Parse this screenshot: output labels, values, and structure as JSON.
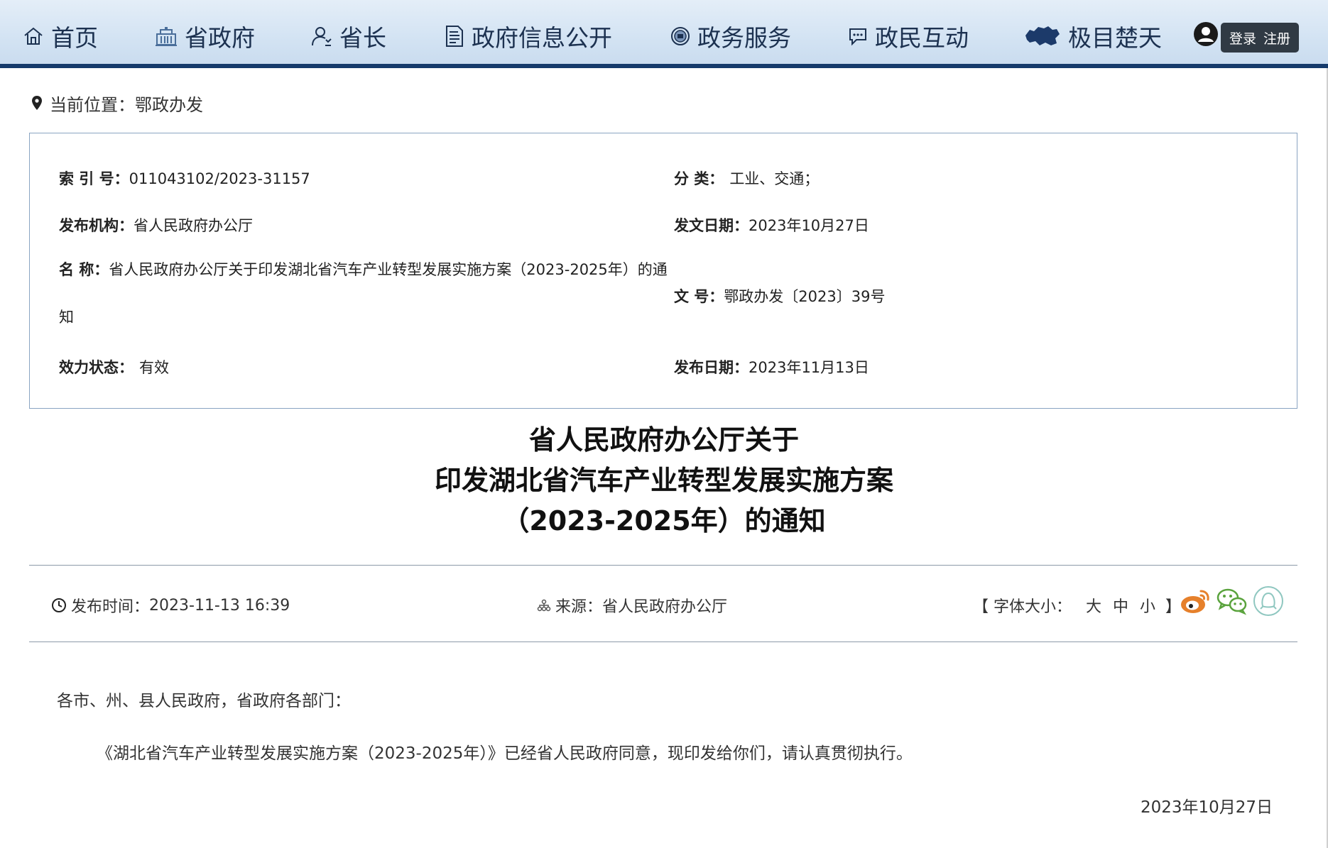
{
  "nav": {
    "items": [
      {
        "label": "首页",
        "icon": "home-icon"
      },
      {
        "label": "省政府",
        "icon": "government-building-icon"
      },
      {
        "label": "省长",
        "icon": "governor-icon"
      },
      {
        "label": "政府信息公开",
        "icon": "document-icon"
      },
      {
        "label": "政务服务",
        "icon": "emblem-icon"
      },
      {
        "label": "政民互动",
        "icon": "chat-icon"
      },
      {
        "label": "极目楚天",
        "icon": "hubei-map-icon"
      }
    ],
    "login": "登录",
    "register": "注册"
  },
  "breadcrumb": {
    "label": "当前位置：",
    "value": "鄂政办发"
  },
  "meta": {
    "index_label": "索 引 号：",
    "index_value": "011043102/2023-31157",
    "category_label": "分 类：",
    "category_value": "工业、交通；",
    "publisher_label": "发布机构：",
    "publisher_value": "省人民政府办公厅",
    "issue_date_label": "发文日期：",
    "issue_date_value": "2023年10月27日",
    "name_label": "名 称：",
    "name_value": "省人民政府办公厅关于印发湖北省汽车产业转型发展实施方案（2023-2025年）的通知",
    "doc_no_label": "文 号：",
    "doc_no_value": "鄂政办发〔2023〕39号",
    "status_label": "效力状态：",
    "status_value": "有效",
    "publish_date_label": "发布日期：",
    "publish_date_value": "2023年11月13日"
  },
  "title": {
    "line1": "省人民政府办公厅关于",
    "line2": "印发湖北省汽车产业转型发展实施方案",
    "line3": "（2023-2025年）的通知"
  },
  "info": {
    "time_label": "发布时间：",
    "time_value": "2023-11-13 16:39",
    "source_label": "来源：",
    "source_value": "省人民政府办公厅",
    "font_open": "【 字体大小：",
    "font_large": "大",
    "font_medium": "中",
    "font_small": "小",
    "font_close": "】"
  },
  "share": {
    "icons": [
      "weibo-icon",
      "wechat-icon",
      "qq-icon"
    ],
    "colors": {
      "weibo": "#e6802b",
      "wechat": "#5aa33d",
      "qq": "#8fc7c0"
    }
  },
  "body": {
    "salutation": "各市、州、县人民政府，省政府各部门：",
    "paragraph": "《湖北省汽车产业转型发展实施方案（2023-2025年）》已经省人民政府同意，现印发给你们，请认真贯彻执行。",
    "date": "2023年10月27日"
  },
  "colors": {
    "nav_border": "#153a6b",
    "nav_text": "#1c3150",
    "box_border": "#8aa4c2"
  }
}
